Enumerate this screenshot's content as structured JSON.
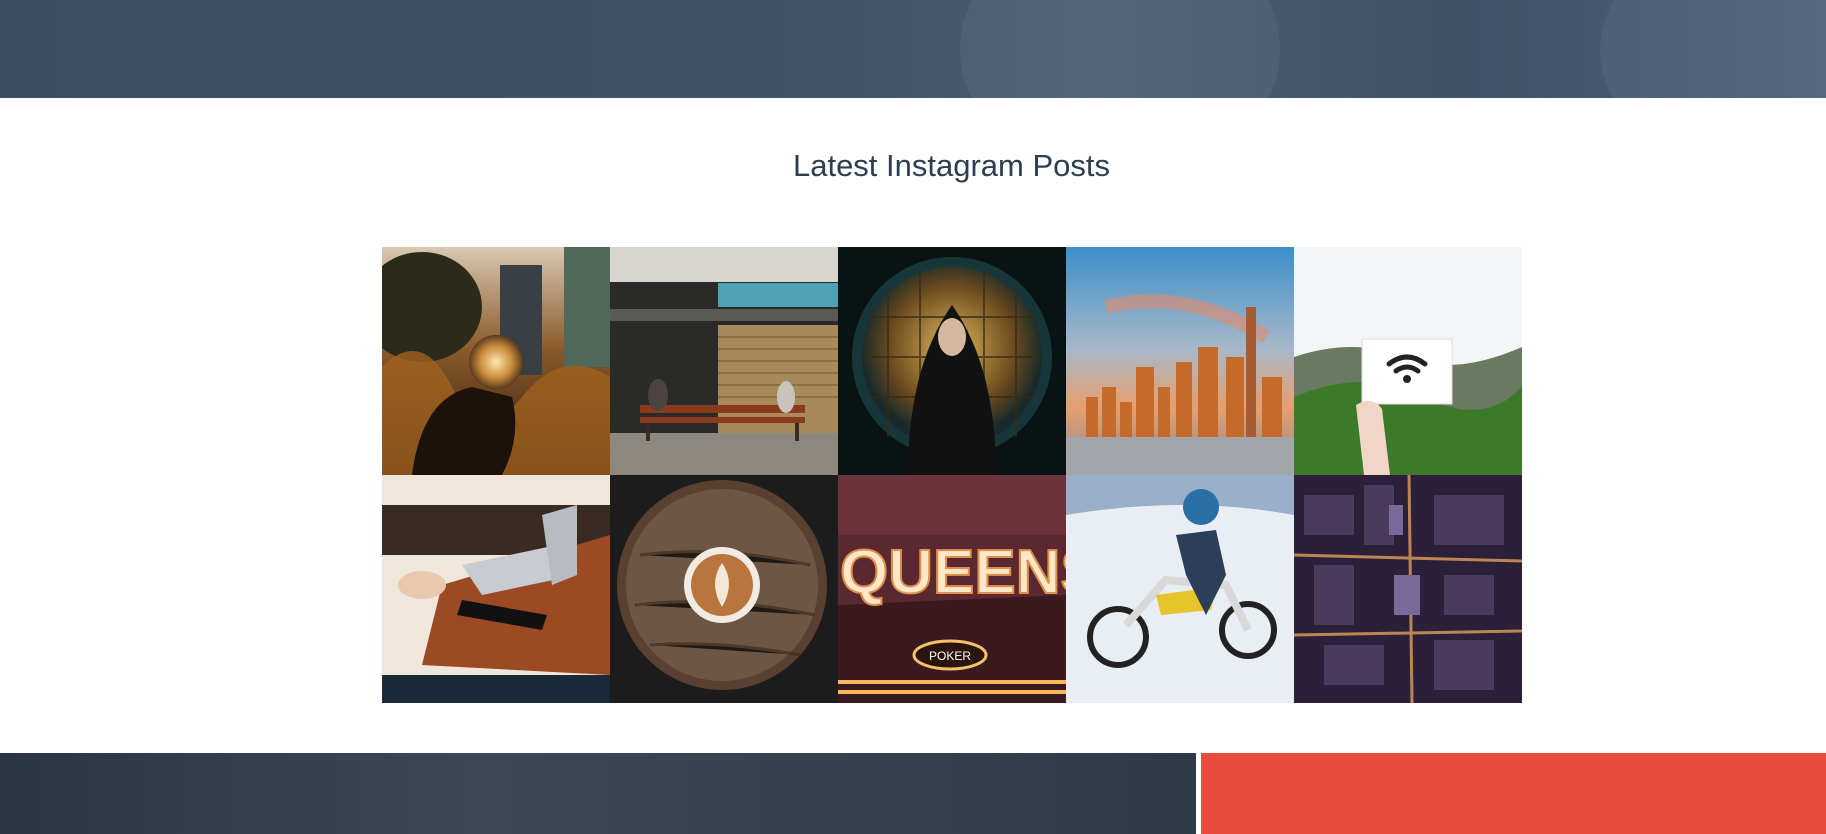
{
  "section": {
    "title": "Latest Instagram Posts"
  },
  "colors": {
    "banner": "#3b4d62",
    "title_text": "#2c3e50",
    "accent": "#e74c3c",
    "footer_dark": "#2e3a48"
  },
  "posts": [
    {
      "subject": "hand holding crystal ball near city buildings"
    },
    {
      "subject": "two people on a wooden bench by a shop shutter"
    },
    {
      "subject": "hooded woman in front of a round lit window"
    },
    {
      "subject": "city skyline at sunset over river"
    },
    {
      "subject": "hand holding card with wifi symbol"
    },
    {
      "subject": "laptop and phone on wooden desk"
    },
    {
      "subject": "latte art on a round wooden table"
    },
    {
      "subject": "QUEENS illuminated marquee sign",
      "sign_text": "QUEENS",
      "badge_text": "POKER"
    },
    {
      "subject": "motocross rider on snow"
    },
    {
      "subject": "aerial view of city at night"
    }
  ]
}
